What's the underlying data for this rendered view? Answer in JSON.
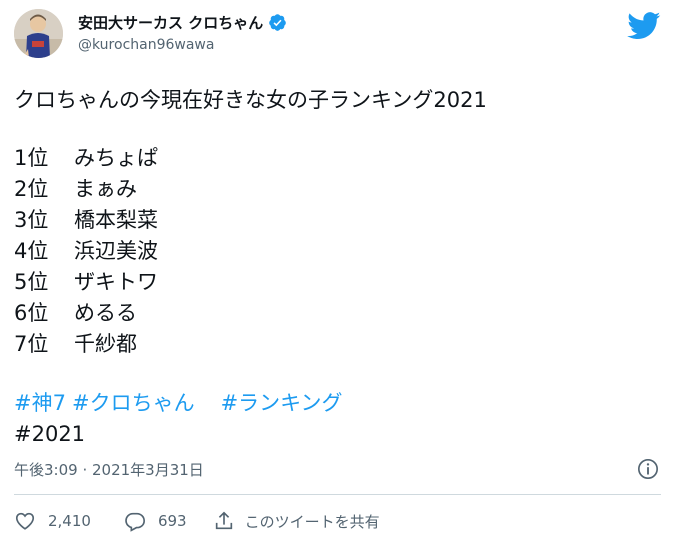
{
  "user": {
    "display_name": "安田大サーカス クロちゃん",
    "handle": "@kurochan96wawa",
    "verified": true
  },
  "tweet": {
    "title_line": "クロちゃんの今現在好きな女の子ランキング2021",
    "ranking": [
      {
        "rank": "1位",
        "name": "みちょぱ"
      },
      {
        "rank": "2位",
        "name": "まぁみ"
      },
      {
        "rank": "3位",
        "name": "橋本梨菜"
      },
      {
        "rank": "4位",
        "name": "浜辺美波"
      },
      {
        "rank": "5位",
        "name": "ザキトワ"
      },
      {
        "rank": "6位",
        "name": "めるる"
      },
      {
        "rank": "7位",
        "name": "千紗都"
      }
    ],
    "hashtags": [
      "#神7",
      "#クロちゃん",
      "#ランキング"
    ],
    "last_line": "#2021",
    "timestamp": "午後3:09 · 2021年3月31日"
  },
  "actions": {
    "likes": "2,410",
    "replies": "693",
    "share_label": "このツイートを共有"
  },
  "icons": {
    "logo": "twitter-bird-icon",
    "verified": "verified-badge-icon",
    "info": "info-icon",
    "like": "heart-icon",
    "reply": "reply-bubble-icon",
    "share": "share-icon"
  },
  "colors": {
    "accent": "#1d9bf0",
    "text": "#0f1419",
    "muted": "#536471"
  }
}
